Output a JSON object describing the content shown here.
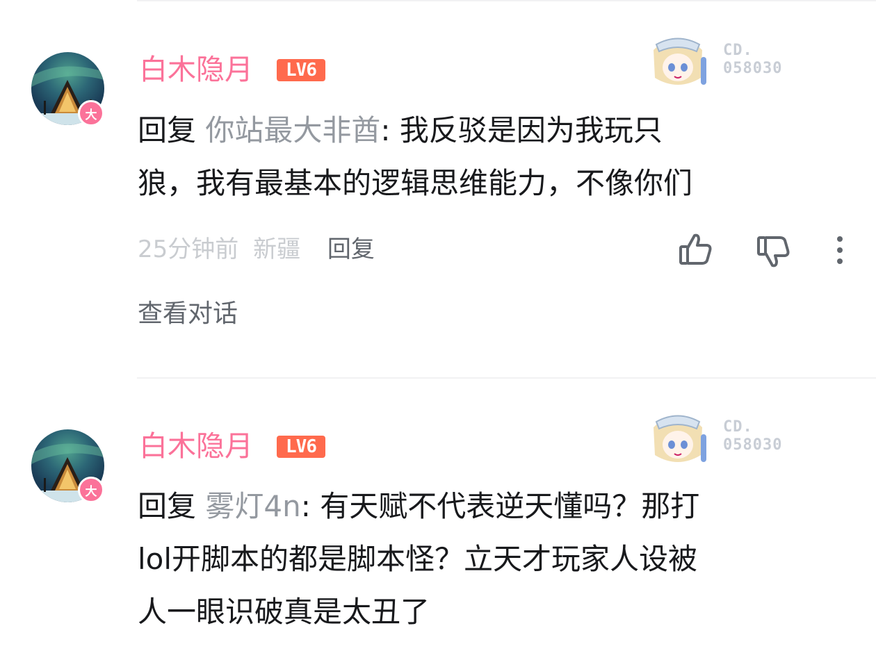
{
  "comments": [
    {
      "username": "白木隐月",
      "level": "LV6",
      "avatar_badge": "大",
      "decoration_no_line1": "CD.",
      "decoration_no_line2": "058030",
      "reply_prefix": "回复",
      "reply_to": "你站最大非酋",
      "text_line1": ": 我反驳是因为我玩只",
      "text_line2": "狼，我有最基本的逻辑思维能力，不像你们",
      "time": "25分钟前",
      "location": "新疆",
      "reply_label": "回复",
      "view_conversation": "查看对话",
      "icons": [
        "like-icon",
        "dislike-icon",
        "more-icon"
      ]
    },
    {
      "username": "白木隐月",
      "level": "LV6",
      "avatar_badge": "大",
      "decoration_no_line1": "CD.",
      "decoration_no_line2": "058030",
      "reply_prefix": "回复",
      "reply_to": "雾灯4n",
      "text_line1": ": 有天赋不代表逆天懂吗？那打",
      "text_line2": "lol开脚本的都是脚本怪？立天才玩家人设被",
      "text_line3": "人一眼识破真是太丑了"
    }
  ],
  "colors": {
    "accent": "#fb7299",
    "level": "#ff6a4d",
    "meta": "#c9ccd0",
    "text": "#18191c"
  }
}
